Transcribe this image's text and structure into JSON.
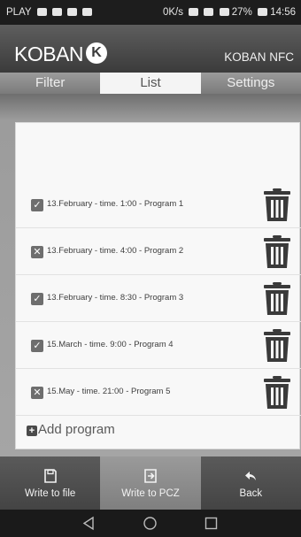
{
  "status_bar": {
    "carrier": "PLAY",
    "net_speed": "0K/s",
    "network": "LTE",
    "battery": "27%",
    "time": "14:56"
  },
  "header": {
    "logo_text": "KOBAN",
    "logo_mark": "K",
    "title": "KOBAN NFC"
  },
  "tabs": [
    {
      "label": "Filter",
      "active": false
    },
    {
      "label": "List",
      "active": true
    },
    {
      "label": "Settings",
      "active": false
    }
  ],
  "programs": [
    {
      "label": "13.February - time. 1:00 - Program 1",
      "checked": true
    },
    {
      "label": "13.February - time. 4:00 - Program 2",
      "checked": false
    },
    {
      "label": "13.February - time. 8:30 - Program 3",
      "checked": true
    },
    {
      "label": "15.March - time. 9:00 - Program 4",
      "checked": true
    },
    {
      "label": "15.May - time. 21:00 - Program 5",
      "checked": false
    }
  ],
  "add_program_label": "Add program",
  "bottom_actions": [
    {
      "label": "Write to file",
      "icon": "floppy-disk-icon"
    },
    {
      "label": "Write to PCZ",
      "icon": "export-icon"
    },
    {
      "label": "Back",
      "icon": "reply-arrow-icon"
    }
  ],
  "colors": {
    "status_bar": "#1d1d1d",
    "header": "#4a4a4a",
    "active_tab": "#f4f4f4",
    "content_bg": "#a5a5a5",
    "card": "#f8f8f8",
    "checkbox": "#6e6e6e",
    "trash": "#3a3a3a"
  }
}
